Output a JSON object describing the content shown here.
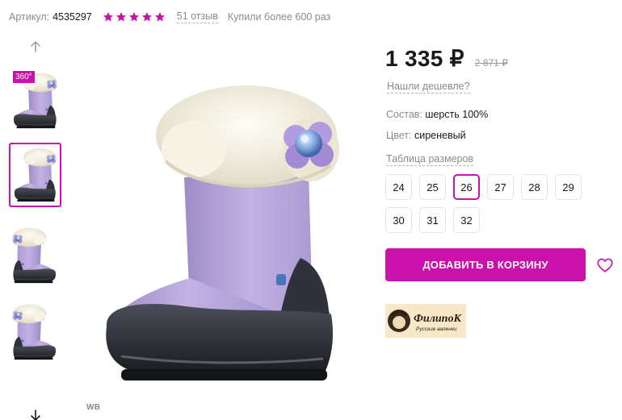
{
  "header": {
    "article_label": "Артикул:",
    "article_number": "4535297",
    "rating_stars": 5,
    "reviews_text": "51 отзыв",
    "bought_text": "Купили более 600 раз"
  },
  "gallery": {
    "badge_360": "360°",
    "selected_index": 1,
    "thumbnail_count": 4,
    "watermark": "WB"
  },
  "product": {
    "price": "1 335 ₽",
    "old_price": "2 871 ₽",
    "cheaper_link": "Нашли дешевле?",
    "composition_label": "Состав:",
    "composition_value": "шерсть 100%",
    "color_label": "Цвет:",
    "color_value": "сиреневый",
    "size_table_link": "Таблица размеров",
    "sizes": [
      "24",
      "25",
      "26",
      "27",
      "28",
      "29",
      "30",
      "31",
      "32"
    ],
    "selected_size": "26",
    "add_to_cart": "ДОБАВИТЬ В КОРЗИНУ"
  },
  "brand": {
    "name": "ФилипоК",
    "tagline": "Русские валенки"
  },
  "icons": {
    "star": "star-icon",
    "arrow_up": "arrow-up-icon",
    "arrow_down": "arrow-down-icon",
    "favorite": "heart-icon"
  },
  "colors": {
    "accent": "#cb11ab",
    "star": "#cb11ab",
    "boot_felt": "#b9a7db",
    "boot_sole": "#2a2d33",
    "fur": "#f3efe2"
  }
}
